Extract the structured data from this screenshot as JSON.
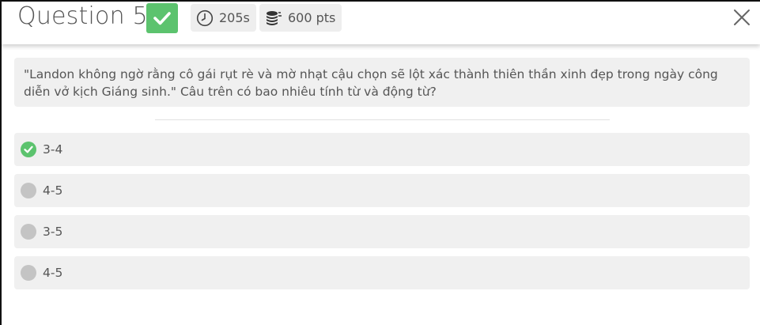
{
  "header": {
    "question_label": "Question 5",
    "timer": "205s",
    "points": "600 pts",
    "icons": {
      "status": "checkmark-icon",
      "timer": "clock-icon",
      "points": "coins-icon",
      "close": "close-icon"
    }
  },
  "question": {
    "text": "\"Landon không ngờ rằng cô gái rụt rè và mờ nhạt cậu chọn sẽ lột xác thành thiên thần xinh đẹp trong ngày công diễn vở kịch Giáng sinh.\" Câu trên có bao nhiêu tính từ và động từ?"
  },
  "answers": [
    {
      "label": "3-4",
      "correct": true
    },
    {
      "label": "4-5",
      "correct": false
    },
    {
      "label": "3-5",
      "correct": false
    },
    {
      "label": "4-5",
      "correct": false
    }
  ],
  "colors": {
    "correct": "#5cc36e",
    "neutral": "#c4c4c4",
    "panel": "#f0f0f0"
  }
}
